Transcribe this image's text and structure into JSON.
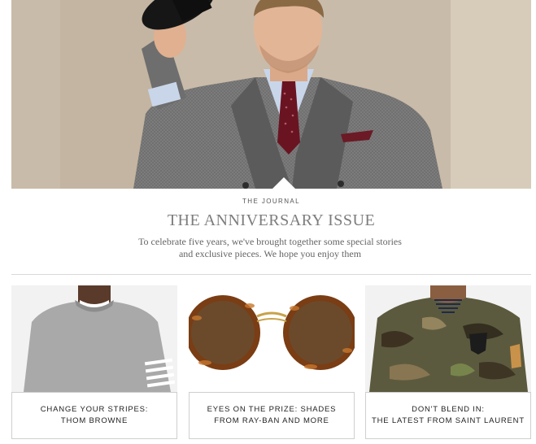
{
  "hero": {
    "image_icon": "model-in-grey-suit-tipping-hat-photo",
    "colors": {
      "suit": "#6f6f6f",
      "shirt": "#c9d6ea",
      "tie": "#6a1422",
      "background": "#c4b5a2"
    }
  },
  "journal": {
    "kicker": "THE JOURNAL",
    "title": "THE ANNIVERSARY ISSUE",
    "intro": "To celebrate five years, we've brought together some special stories and exclusive pieces. We hope you enjoy them"
  },
  "cards": [
    {
      "image_icon": "grey-sweatshirt-photo",
      "label": "CHANGE YOUR STRIPES:\nTHOM BROWNE"
    },
    {
      "image_icon": "tortoiseshell-sunglasses-photo",
      "label": "EYES ON THE PRIZE: SHADES\nFROM RAY-BAN AND MORE"
    },
    {
      "image_icon": "camouflage-jacket-photo",
      "label": "DON'T BLEND IN:\nTHE LATEST FROM SAINT LAURENT"
    }
  ]
}
